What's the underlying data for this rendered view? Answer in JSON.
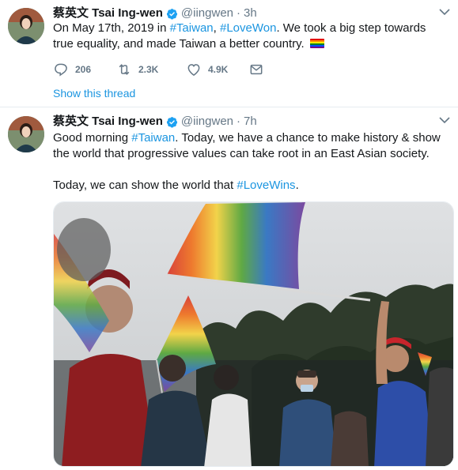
{
  "tweets": [
    {
      "author_name": "蔡英文 Tsai Ing-wen",
      "handle": "@iingwen",
      "separator": "·",
      "time": "3h",
      "text_parts": {
        "p1": "On May 17th, 2019 in ",
        "tag1": "#Taiwan",
        "p2": ", ",
        "tag2": "#LoveWon",
        "p3": ". We took a big step towards true equality, and made Taiwan a better country. "
      },
      "reply_count": "206",
      "retweet_count": "2.3K",
      "like_count": "4.9K",
      "show_thread": "Show this thread"
    },
    {
      "author_name": "蔡英文 Tsai Ing-wen",
      "handle": "@iingwen",
      "separator": "·",
      "time": "7h",
      "text_parts": {
        "p1": "Good morning ",
        "tag1": "#Taiwan",
        "p2": ". Today, we have a chance to make history & show the world that progressive values can take root in an East Asian society.",
        "p3": "Today, we can show the world that ",
        "tag2": "#LoveWins",
        "p4": "."
      }
    }
  ],
  "icons": {
    "verified": "verified-badge-icon",
    "caret": "chevron-down-icon",
    "reply": "reply-icon",
    "retweet": "retweet-icon",
    "like": "heart-icon",
    "dm": "envelope-icon",
    "flag": "rainbow-flag-emoji"
  },
  "colors": {
    "link": "#1b95e0",
    "secondary": "#657786",
    "verified": "#1da1f2"
  }
}
